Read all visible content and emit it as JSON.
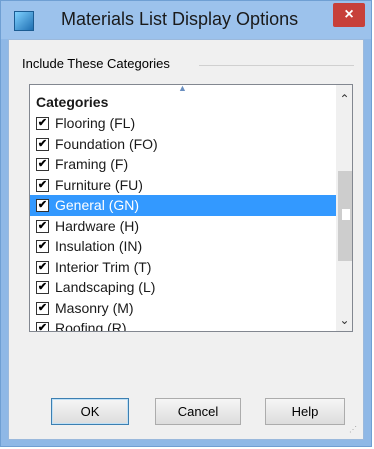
{
  "window": {
    "title": "Materials List Display Options",
    "close_label": "×"
  },
  "group": {
    "label": "Include These Categories"
  },
  "list": {
    "header": "Categories",
    "items": [
      {
        "label": "Flooring (FL)",
        "checked": true,
        "selected": false
      },
      {
        "label": "Foundation (FO)",
        "checked": true,
        "selected": false
      },
      {
        "label": "Framing (F)",
        "checked": true,
        "selected": false
      },
      {
        "label": "Furniture (FU)",
        "checked": true,
        "selected": false
      },
      {
        "label": "General (GN)",
        "checked": true,
        "selected": true
      },
      {
        "label": "Hardware (H)",
        "checked": true,
        "selected": false
      },
      {
        "label": "Insulation (IN)",
        "checked": true,
        "selected": false
      },
      {
        "label": "Interior Trim (T)",
        "checked": true,
        "selected": false
      },
      {
        "label": "Landscaping (L)",
        "checked": true,
        "selected": false
      },
      {
        "label": "Masonry (M)",
        "checked": true,
        "selected": false
      },
      {
        "label": "Roofing (R)",
        "checked": true,
        "selected": false
      }
    ]
  },
  "buttons": {
    "ok": "OK",
    "cancel": "Cancel",
    "help": "Help"
  },
  "icons": {
    "check": "✔",
    "scroll_up": "⌃",
    "scroll_down": "⌄",
    "sort": "▲"
  },
  "colors": {
    "selection": "#3399ff",
    "close_button": "#c7403a",
    "titlebar": "#9cc2ec"
  }
}
